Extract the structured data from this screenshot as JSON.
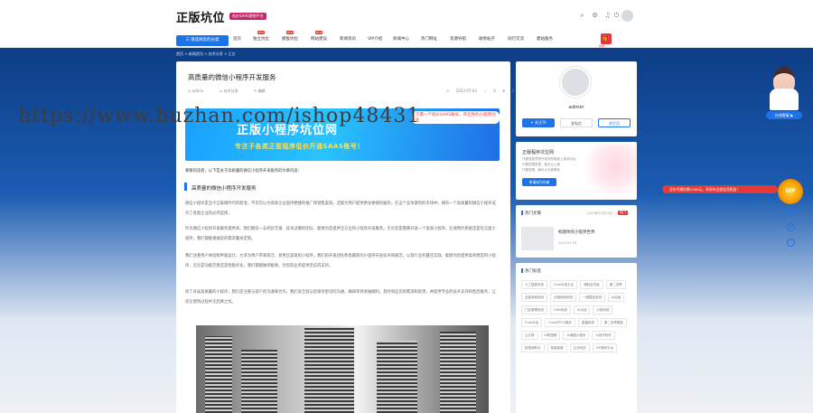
{
  "header": {
    "logo": "正版坑位",
    "logo_tag": "低价SAAS营销平台",
    "icons": [
      "search-icon",
      "gear-icon",
      "bell-icon",
      "power-icon",
      "avatar"
    ]
  },
  "nav": {
    "category_button": "☰ 请选择您的分类",
    "items": [
      {
        "label": "首页",
        "hot": false
      },
      {
        "label": "独立坑位",
        "hot": true
      },
      {
        "label": "模板坑位",
        "hot": true
      },
      {
        "label": "网站建设",
        "hot": true
      },
      {
        "label": "新闻资讯",
        "hot": false
      },
      {
        "label": "VIP介绍",
        "hot": false
      },
      {
        "label": "商城中心",
        "hot": false
      },
      {
        "label": "热门网址",
        "hot": false
      },
      {
        "label": "资源导航",
        "hot": false
      },
      {
        "label": "收购帖子",
        "hot": false
      },
      {
        "label": "同行交流",
        "hot": false
      },
      {
        "label": "建站服务",
        "hot": false
      }
    ],
    "hot_badge": "HOT",
    "promo_label": "优惠"
  },
  "breadcrumb": "首页 > 新闻资讯 > 技术分享 > 正文",
  "watermark": "https://www.huzhan.com/ishop48431",
  "article": {
    "title": "高质量的微信小程序开发服务",
    "author": "admin",
    "category": "技术分享",
    "edit": "编辑",
    "date": "2023-07-03",
    "likes": "0",
    "comments": "2",
    "banner": {
      "title": "正版小程序坑位网",
      "subtitle": "专注子各类正版程序低价开通SAAS账号！",
      "pill": "只需一个低价SAAS账号，开启你的小程序创业"
    },
    "intro": "尊敬的读者，以下是关于高质量的微信小程序开发服务的文章内容：",
    "section_title": "高质量的微信小程序开发服务",
    "paragraphs": [
      "微信小程序是当今互联网时代的新宠，不仅可以为商家企业提供便捷的推广和销售渠道，还能为用户提供更加便捷的服务。在这个竞争激烈的市场中，拥有一个高质量的微信小程序成为了各类企业的必然选择。",
      "作为微信小程序开发服务提供商，我们拥有一支经验丰富、技术过硬的团队，能够为您提供全方位的小程序开发服务。无论您是需要开发一个电商小程序、在线预约系统还是社交类小程序，我们都能根据您的需求量身定制。",
      "我们注重用户体验和界面设计，力求为用户带来简洁、易用且美观的小程序。我们的开发团队熟悉最新的小程序开发技术和规范，以及行业的最佳实践，能够为您提供高效稳定的小程序，无论是功能完善还是性能优化，我们都能做到极致，为您的业务提供坚实的支持。",
      "除了开发高质量的小程序，我们还注重与客户的沟通和合作。我们会全程与您保持密切的沟通，确保项目进展顺利，及时响应您的需求和反馈，并提供专业的技术支持和售后服务，让您在使用过程中无后顾之忧。"
    ]
  },
  "sidebar": {
    "author_name": "admin",
    "follow_button": "+ 关注TA",
    "message_button": "发私信",
    "visit_button": "进主页",
    "recruit": {
      "title": "正版程序坑位网",
      "lines": [
        "只要您愿意把开发好的程序上架到平台，",
        "只要您想发表，就可以上架",
        "只要您想，就可以与我联系"
      ],
      "button": "申请成为作者"
    },
    "hot_title": "热门文章",
    "hot_date": "2023年12月23日",
    "hot_label": "热门",
    "hot_article_title": "构建你的小程序世界",
    "hot_article_meta": "2023-07-03",
    "tags_title": "热门标签",
    "tags": [
      "人工智能系统",
      "Chat对话平台",
      "源码会员版",
      "第二世界",
      "全能商城系统",
      "分销商城系统",
      "一键建站系统",
      "AI绘画",
      "门店管理系统",
      "CRM系统",
      "AI对话",
      "分销系统",
      "Chat对话",
      "ChatGPT小程序",
      "直播系统",
      "第二世界模板",
      "云计算",
      "AI短视频",
      "AI海报小程序",
      "AI创作软件",
      "短视频助手",
      "智能客服",
      "企业网站",
      "VIP源码平台"
    ]
  },
  "float": {
    "service_label": "在线客服 ▶",
    "red_pill": "全年代理仅需1000元，享所有全部会员权益！",
    "vip": "VIP",
    "icons": [
      "message-icon",
      "share-icon",
      "up-arrow-icon"
    ]
  }
}
